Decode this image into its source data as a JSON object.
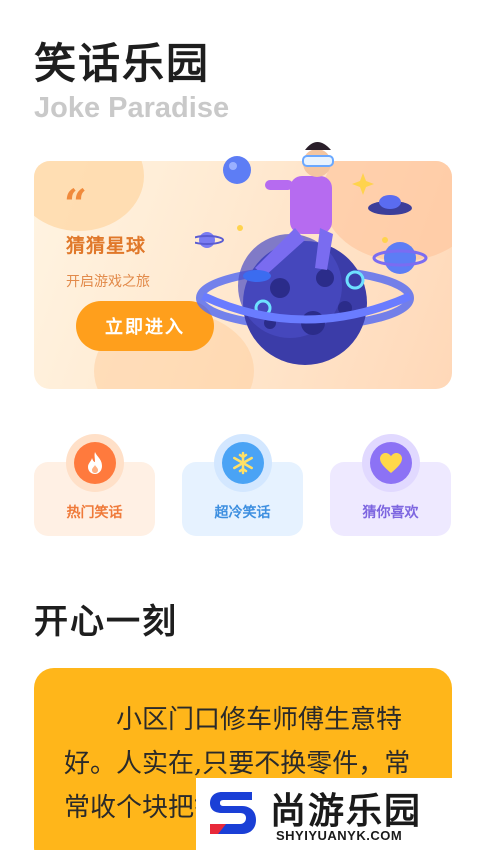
{
  "header": {
    "title": "笑话乐园",
    "subtitle": "Joke Paradise"
  },
  "banner": {
    "quote_mark": "“",
    "title": "猜猜星球",
    "subtitle": "开启游戏之旅",
    "button_label": "立即进入"
  },
  "categories": [
    {
      "label": "热门笑话",
      "icon": "fire-icon",
      "color": "#ff7a3d"
    },
    {
      "label": "超冷笑话",
      "icon": "snowflake-icon",
      "color": "#4aa3f5"
    },
    {
      "label": "猜你喜欢",
      "icon": "heart-icon",
      "color": "#8c72f5"
    }
  ],
  "section": {
    "title": "开心一刻"
  },
  "joke": {
    "text": "小区门口修车师傅生意特好。人实在,只要不换零件，常常收个块把钱"
  },
  "watermark": {
    "brand": "尚游乐园",
    "url": "SHYIYUANYK.COM"
  },
  "colors": {
    "accent_orange": "#ff9f1c",
    "card_yellow": "#ffb61a"
  }
}
